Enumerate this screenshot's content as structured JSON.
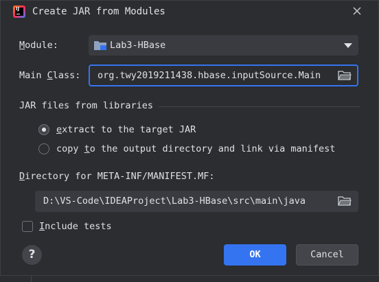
{
  "window": {
    "title": "Create JAR from Modules",
    "icon": "intellij-idea-icon",
    "close_icon": "close-icon"
  },
  "module": {
    "label": "odule:",
    "label_mnemonic": "M",
    "value": "Lab3-HBase",
    "icon": "module-folder-icon"
  },
  "main_class": {
    "label_prefix": "Main ",
    "label_mnemonic": "C",
    "label_suffix": "lass:",
    "value": "org.twy2019211438.hbase.inputSource.Main"
  },
  "jar_section": {
    "title": "JAR files from libraries",
    "options": [
      {
        "label_mnemonic": "e",
        "label_rest": "xtract to the target JAR",
        "checked": true
      },
      {
        "label_prefix": "copy ",
        "label_mnemonic": "t",
        "label_rest": "o the output directory and link via manifest",
        "checked": false
      }
    ]
  },
  "directory": {
    "label_mnemonic": "D",
    "label_rest": "irectory for META-INF/MANIFEST.MF:",
    "value": "D:\\VS-Code\\IDEAProject\\Lab3-HBase\\src\\main\\java"
  },
  "include_tests": {
    "label_mnemonic": "I",
    "label_rest": "nclude tests",
    "checked": false
  },
  "buttons": {
    "help": "?",
    "ok": "OK",
    "cancel": "Cancel"
  },
  "colors": {
    "background": "#2b2d30",
    "accent": "#3574f0",
    "field": "#393b40",
    "text": "#dfe1e5"
  }
}
